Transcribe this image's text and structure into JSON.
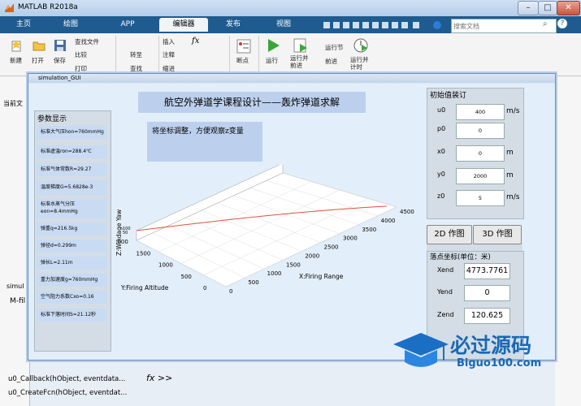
{
  "app": {
    "title": "MATLAB R2018a"
  },
  "window_buttons": {
    "minimize": "–",
    "maximize": "□",
    "close": "✕"
  },
  "tabs": [
    {
      "label": "主页"
    },
    {
      "label": "绘图"
    },
    {
      "label": "APP"
    },
    {
      "label": "编辑器"
    },
    {
      "label": "发布"
    },
    {
      "label": "视图"
    }
  ],
  "search": {
    "placeholder": "搜索文档"
  },
  "ribbon": {
    "new": "新建",
    "open": "打开",
    "save": "保存",
    "find_files": "查找文件",
    "compare": "比较",
    "print": "打印",
    "goto": "转至",
    "find": "查找",
    "insert": "插入",
    "comment": "注释",
    "indent": "缩进",
    "fx": "fx",
    "breakpoints": "断点",
    "run": "运行",
    "run_advance": "运行并\n前进",
    "run_section": "运行节",
    "advance": "前进",
    "run_time": "运行并\n计时"
  },
  "left_pane": {
    "current_folder": "当前文",
    "simulation": "simul",
    "mfile": "M-fil"
  },
  "bottom_list": [
    "u0_Callback(hObject, eventdata...",
    "u0_CreateFcn(hObject, eventdat..."
  ],
  "command_prompt": "fx >>",
  "gui": {
    "window_title": "simulation_GUI",
    "heading": "航空外弹道学课程设计——轰炸弹道求解",
    "note": "将坐标调整，方便观察z变量",
    "params_title": "参数显示",
    "params": [
      "标准大气压hon=760mmHg",
      "标准虚温ron=288.4℃",
      "标准气体常数R=29.27",
      "温度梯度G=5.6828e-3",
      "标准水蒸气分压eon=8.4mmHg",
      "弹重q=216.5kg",
      "弹径d=0.299m",
      "弹长L=2.11m",
      "重力加速度g=760mmHg",
      "空气阻力系数Cxo=0.16",
      "标准下落时间S=21.12秒"
    ],
    "init_title": "初始值装订",
    "inputs": [
      {
        "label": "u0",
        "value": "400",
        "unit": "m/s"
      },
      {
        "label": "p0",
        "value": "0",
        "unit": ""
      },
      {
        "label": "x0",
        "value": "0",
        "unit": "m"
      },
      {
        "label": "y0",
        "value": "2000",
        "unit": "m"
      },
      {
        "label": "z0",
        "value": "5",
        "unit": "m/s"
      }
    ],
    "btn_2d": "2D 作图",
    "btn_3d": "3D 作图",
    "impact_title": "落点坐标(单位：米)",
    "impact": [
      {
        "label": "Xend",
        "value": "4773.7761"
      },
      {
        "label": "Yend",
        "value": "0"
      },
      {
        "label": "Zend",
        "value": "120.625"
      }
    ]
  },
  "chart_data": {
    "type": "line",
    "xlabel": "X:Firing Range",
    "ylabel": "Y:Firing Altitude",
    "zlabel": "Z:Windage Yaw",
    "x_ticks": [
      "0",
      "500",
      "1000",
      "1500",
      "2000",
      "2500",
      "3000",
      "3500",
      "4000",
      "4500"
    ],
    "y_ticks": [
      "0",
      "500",
      "1000",
      "1500",
      "2000"
    ],
    "z_ticks": [
      "100",
      "50"
    ],
    "series": [
      {
        "color": "#e0523a"
      }
    ],
    "grid": true
  },
  "watermark": {
    "title": "必过源码",
    "url": "Biguo100.com"
  }
}
